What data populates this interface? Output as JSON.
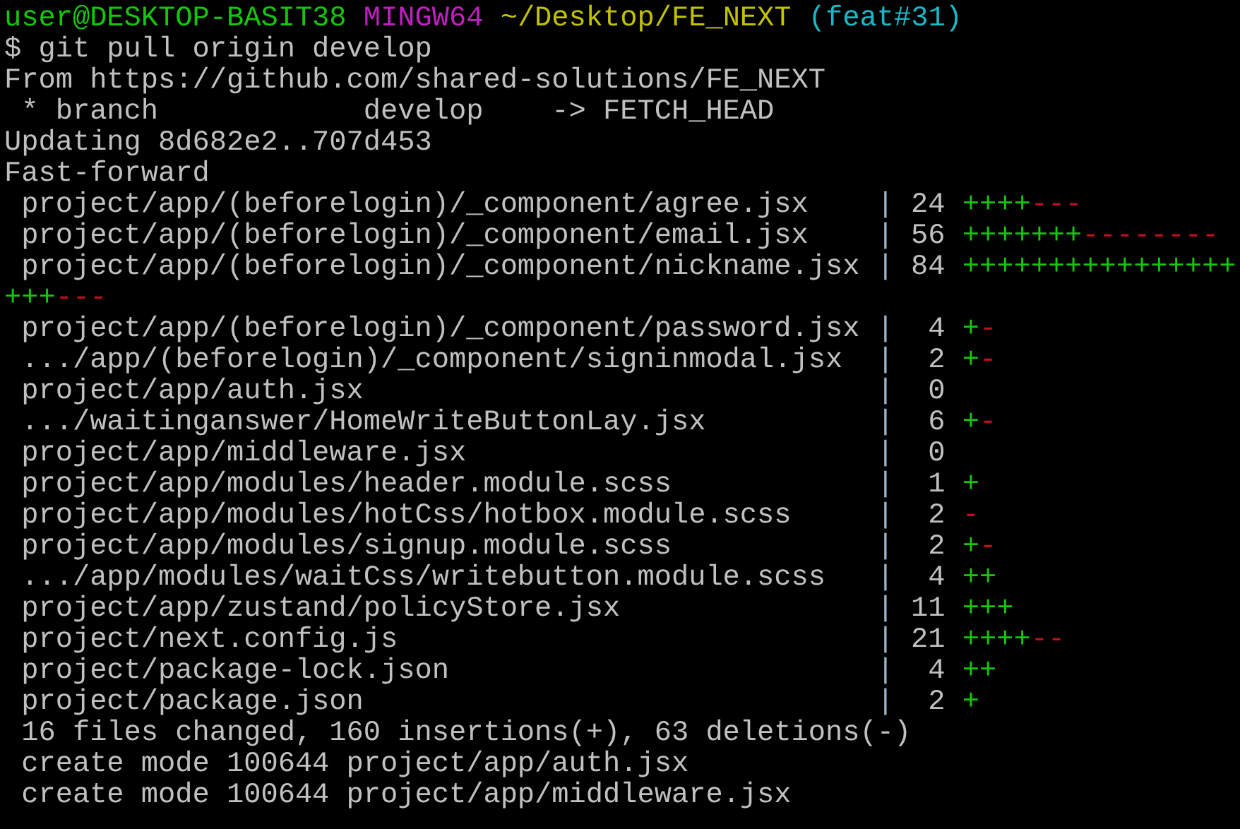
{
  "prompt": {
    "user_host": "user@DESKTOP-BASIT38",
    "system": "MINGW64",
    "path": "~/Desktop/FE_NEXT",
    "branch": "(feat#31)"
  },
  "lines": [
    {
      "kind": "command",
      "text": "$ git pull origin develop"
    },
    {
      "kind": "output",
      "text": "From https://github.com/shared-solutions/FE_NEXT"
    },
    {
      "kind": "output",
      "text": " * branch            develop    -> FETCH_HEAD"
    },
    {
      "kind": "output",
      "text": "Updating 8d682e2..707d453"
    },
    {
      "kind": "output",
      "text": "Fast-forward"
    },
    {
      "kind": "stat",
      "path": "project/app/(beforelogin)/_component/agree.jsx",
      "separator": "|",
      "count": "24",
      "added": "++++",
      "removed": "---"
    },
    {
      "kind": "stat",
      "path": "project/app/(beforelogin)/_component/email.jsx",
      "separator": "|",
      "count": "56",
      "added": "+++++++",
      "removed": "--------"
    },
    {
      "kind": "stat",
      "path": "project/app/(beforelogin)/_component/nickname.jsx",
      "separator": "|",
      "count": "84",
      "added": "++++++++++++++++"
    },
    {
      "kind": "graph",
      "added": "+++",
      "removed": "---"
    },
    {
      "kind": "stat",
      "path": "project/app/(beforelogin)/_component/password.jsx",
      "separator": "|",
      "count": "4",
      "added": "+",
      "removed": "-"
    },
    {
      "kind": "stat",
      "path": ".../app/(beforelogin)/_component/signinmodal.jsx",
      "separator": "|",
      "count": "2",
      "added": "+",
      "removed": "-"
    },
    {
      "kind": "stat",
      "path": "project/app/auth.jsx",
      "separator": "|",
      "count": "0"
    },
    {
      "kind": "stat",
      "path": ".../waitinganswer/HomeWriteButtonLay.jsx",
      "separator": "|",
      "count": "6",
      "added": "+",
      "removed": "-"
    },
    {
      "kind": "stat",
      "path": "project/app/middleware.jsx",
      "separator": "|",
      "count": "0"
    },
    {
      "kind": "stat",
      "path": "project/app/modules/header.module.scss",
      "separator": "|",
      "count": "1",
      "added": "+"
    },
    {
      "kind": "stat",
      "path": "project/app/modules/hotCss/hotbox.module.scss",
      "separator": "|",
      "count": "2",
      "removed": "-"
    },
    {
      "kind": "stat",
      "path": "project/app/modules/signup.module.scss",
      "separator": "|",
      "count": "2",
      "added": "+",
      "removed": "-"
    },
    {
      "kind": "stat",
      "path": ".../app/modules/waitCss/writebutton.module.scss",
      "separator": "|",
      "count": "4",
      "added": "++"
    },
    {
      "kind": "stat",
      "path": "project/app/zustand/policyStore.jsx",
      "separator": "|",
      "count": "11",
      "added": "+++"
    },
    {
      "kind": "stat",
      "path": "project/next.config.js",
      "separator": "|",
      "count": "21",
      "added": "++++",
      "removed": "--"
    },
    {
      "kind": "stat",
      "path": "project/package-lock.json",
      "separator": "|",
      "count": "4",
      "added": "++"
    },
    {
      "kind": "stat",
      "path": "project/package.json",
      "separator": "|",
      "count": "2",
      "added": "+"
    },
    {
      "kind": "output",
      "text": " 16 files changed, 160 insertions(+), 63 deletions(-)"
    },
    {
      "kind": "output",
      "text": " create mode 100644 project/app/auth.jsx"
    },
    {
      "kind": "output",
      "text": " create mode 100644 project/app/middleware.jsx"
    }
  ]
}
